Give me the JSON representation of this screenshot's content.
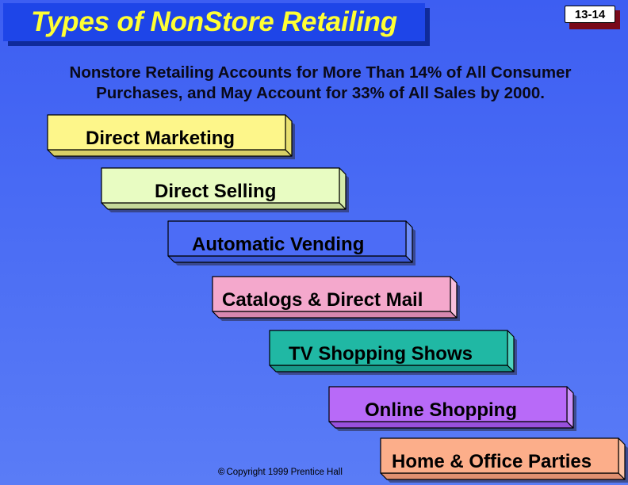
{
  "slide": {
    "title": "Types of NonStore Retailing",
    "page_number": "13-14",
    "subtitle_line1": "Nonstore Retailing Accounts for More Than 14% of All Consumer",
    "subtitle_line2": "Purchases, and May Account for 33% of All Sales by 2000.",
    "copyright_icon": "copyright-icon",
    "copyright_symbol": "©",
    "copyright_text": "Copyright 1999 Prentice Hall"
  },
  "boxes": [
    {
      "label": "Direct Marketing",
      "face": "#fdf68a",
      "side": "#e8e070",
      "bottom": "#d8cf66"
    },
    {
      "label": "Direct Selling",
      "face": "#e8fcc2",
      "side": "#d6ecaa",
      "bottom": "#c4d898"
    },
    {
      "label": "Automatic Vending",
      "face": "#4c6cf6",
      "side": "#6f8ef8",
      "bottom": "#3a58d8"
    },
    {
      "label": "Catalogs & Direct Mail",
      "face": "#f4a8cc",
      "side": "#f8c0dc",
      "bottom": "#d888b0"
    },
    {
      "label": "TV Shopping Shows",
      "face": "#20b8a4",
      "side": "#50d4c0",
      "bottom": "#189888"
    },
    {
      "label": "Online Shopping",
      "face": "#b86af8",
      "side": "#cc94fa",
      "bottom": "#9850dc"
    },
    {
      "label": "Home & Office Parties",
      "face": "#fcae8a",
      "side": "#fcc4a6",
      "bottom": "#e09070"
    }
  ]
}
